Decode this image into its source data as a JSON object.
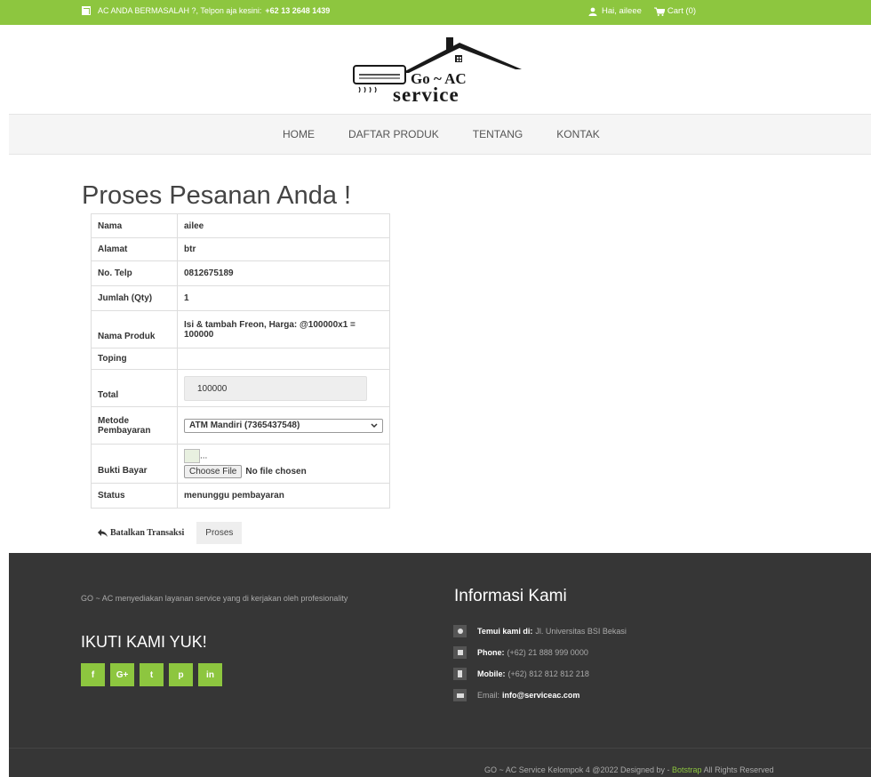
{
  "topbar": {
    "notice": "AC ANDA BERMASALAH ?, Telpon aja kesini:",
    "phone": "+62 13 2648 1439",
    "greeting": "Hai, aileee",
    "cart": "Cart (0)"
  },
  "logo": {
    "line1": "Go ~ AC",
    "line2": "service"
  },
  "nav": {
    "items": [
      "HOME",
      "DAFTAR PRODUK",
      "TENTANG",
      "KONTAK"
    ]
  },
  "page": {
    "title": "Proses Pesanan Anda !"
  },
  "order": {
    "nama_label": "Nama",
    "nama": "ailee",
    "alamat_label": "Alamat",
    "alamat": "btr",
    "telp_label": "No. Telp",
    "telp": "0812675189",
    "qty_label": "Jumlah (Qty)",
    "qty": "1",
    "produk_label": "Nama Produk",
    "produk": "Isi & tambah Freon, Harga: @100000x1 = 100000",
    "toping_label": "Toping",
    "toping": "",
    "total_label": "Total",
    "total": "100000",
    "metode_label": "Metode Pembayaran",
    "metode": "ATM Mandiri (7365437548)",
    "bukti_label": "Bukti Bayar",
    "bukti_img": "...",
    "file_btn": "Choose File",
    "file_status": "No file chosen",
    "status_label": "Status",
    "status": "menunggu pembayaran"
  },
  "actions": {
    "cancel": "Batalkan Transaksi",
    "submit": "Proses"
  },
  "footer": {
    "description": "GO ~ AC menyediakan layanan service yang di kerjakan oleh profesionality",
    "follow_title": "IKUTI KAMI YUK!",
    "socials": [
      "facebook-icon",
      "google-plus-icon",
      "twitter-icon",
      "pinterest-icon",
      "linkedin-icon"
    ],
    "social_glyphs": [
      "f",
      "G+",
      "t",
      "p",
      "in"
    ],
    "info_title": "Informasi Kami",
    "address_label": "Temui kami di:",
    "address": "Jl. Universitas BSI Bekasi",
    "phone_label": "Phone:",
    "phone": "(+62) 21 888 999 0000",
    "mobile_label": "Mobile:",
    "mobile": "(+62) 812 812 812 218",
    "email_label": "Email:",
    "email": "info@serviceac.com",
    "copyright_pre": "GO ~ AC Service Kelompok 4 @2022 Designed by -",
    "copyright_brand": "Botstrap",
    "copyright_post": "All Rights Reserved"
  },
  "colors": {
    "accent": "#8dc63f",
    "footer_bg": "#363636"
  }
}
